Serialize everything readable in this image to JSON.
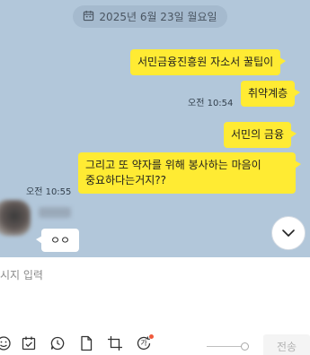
{
  "date_divider": "2025년 6월 23일 월요일",
  "messages": {
    "sent_1": "서민금융진흥원 자소서 꿀팁이",
    "sent_2": "취약계층",
    "sent_2_time": "오전 10:54",
    "sent_3": "서민의 금융",
    "sent_4_line1": "그리고 또 약자를 위해 봉사하는 마음이",
    "sent_4_line2": "중요하다는거지??",
    "sent_4_time": "오전 10:55",
    "received_1": "ㅇㅇ"
  },
  "input": {
    "placeholder": "시지 입력"
  },
  "toolbar": {
    "send_label": "전송",
    "ai_badge": "가",
    "notification_color": "#f05a3c"
  },
  "colors": {
    "chat_background": "#b2c7da",
    "sent_bubble": "#ffeb33",
    "received_bubble": "#ffffff"
  },
  "icons": [
    "calendar-icon",
    "chevron-down-icon",
    "emoji-icon",
    "checklist-icon",
    "speech-icon",
    "file-icon",
    "crop-icon",
    "ai-translate-icon"
  ]
}
